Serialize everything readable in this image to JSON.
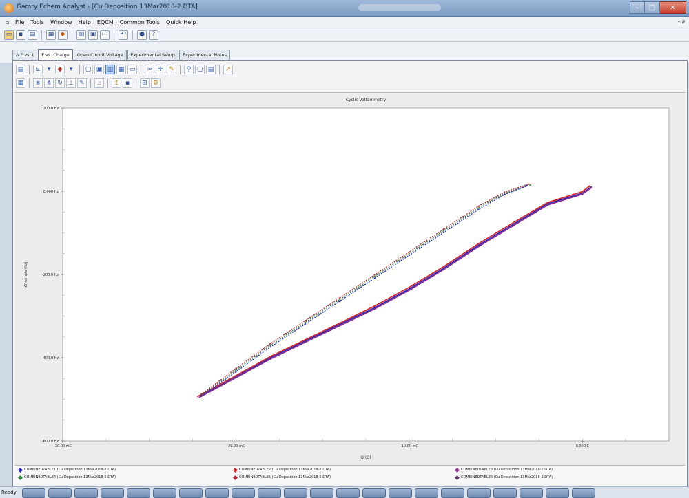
{
  "window": {
    "title": "Gamry Echem Analyst - [Cu Deposition 13Mar2018-2.DTA]",
    "minimize_glyph": "–",
    "maximize_glyph": "□",
    "close_glyph": "✕"
  },
  "menu": {
    "items": [
      "File",
      "Tools",
      "Window",
      "Help",
      "EQCM",
      "Common Tools",
      "Quick Help"
    ],
    "right_glyph": "– ∂"
  },
  "tabs": [
    {
      "label": "Δ F vs. t",
      "active": false
    },
    {
      "label": "F vs. Charge",
      "active": true
    },
    {
      "label": "Open Circuit Voltage",
      "active": false
    },
    {
      "label": "Experimental Setup",
      "active": false
    },
    {
      "label": "Experimental Notes",
      "active": false
    }
  ],
  "status": {
    "text": "Ready"
  },
  "colors": {
    "series1": "#2b2bc9",
    "series2": "#d42a2a",
    "series3": "#8a2f8a",
    "series4": "#2f8a3c",
    "series5": "#b8283a",
    "series6": "#6a3a6a"
  },
  "legend": [
    {
      "label": "COMBINEDTABLE1 (Cu Deposition 13Mar2018-2.DTA)",
      "color": "#2b2bc9"
    },
    {
      "label": "COMBINEDTABLE2 (Cu Deposition 13Mar2018-2.DTA)",
      "color": "#d42a2a"
    },
    {
      "label": "COMBINEDTABLE3 (Cu Deposition 13Mar2018-2.DTA)",
      "color": "#8a2f8a"
    },
    {
      "label": "COMBINEDTABLE4 (Cu Deposition 13Mar2018-2.DTA)",
      "color": "#2f8a3c"
    },
    {
      "label": "COMBINEDTABLE5 (Cu Deposition 13Mar2018-2.DTA)",
      "color": "#b8283a"
    },
    {
      "label": "COMBINEDTABLE6 (Cu Deposition 13Mar2018-2.DTA)",
      "color": "#6a3a6a"
    }
  ],
  "chart_data": {
    "type": "line",
    "title": "Cyclic Voltammetry",
    "xlabel": "Q (C)",
    "ylabel": "Δf sample (Hz)",
    "xlim": [
      -30,
      5
    ],
    "ylim": [
      -600,
      200
    ],
    "x_ticks": [
      {
        "value": -30,
        "label": "-30.00 mC"
      },
      {
        "value": -20,
        "label": "-20.00 mC"
      },
      {
        "value": -10,
        "label": "-10.00 mC"
      },
      {
        "value": 0,
        "label": "0.000 C"
      }
    ],
    "y_ticks": [
      {
        "value": 200,
        "label": "200.0 Hz"
      },
      {
        "value": 0,
        "label": "0.000 Hz"
      },
      {
        "value": -200,
        "label": "-200.0 Hz"
      },
      {
        "value": -400,
        "label": "-400.0 Hz"
      },
      {
        "value": -600,
        "label": "-600.0 Hz"
      }
    ],
    "grid": false,
    "series": [
      {
        "color": "#2b2bc9",
        "dashed": false,
        "x": [
          -22,
          -20,
          -18,
          -16,
          -14,
          -12,
          -10,
          -8,
          -6,
          -4,
          -2,
          0,
          0.5
        ],
        "y": [
          -490,
          -445,
          -400,
          -360,
          -320,
          -280,
          -235,
          -185,
          -130,
          -80,
          -30,
          -5,
          10
        ]
      },
      {
        "color": "#d42a2a",
        "dashed": false,
        "x": [
          -22.2,
          -20,
          -18,
          -16,
          -14,
          -12,
          -10,
          -8,
          -6,
          -4,
          -2,
          0,
          0.4
        ],
        "y": [
          -493,
          -443,
          -397,
          -357,
          -317,
          -276,
          -231,
          -181,
          -126,
          -76,
          -27,
          -1,
          12
        ]
      },
      {
        "color": "#8a2f8a",
        "dashed": false,
        "x": [
          -22.1,
          -20,
          -18,
          -16,
          -14,
          -12,
          -10,
          -8,
          -6,
          -4,
          -2,
          0,
          0.5
        ],
        "y": [
          -495,
          -448,
          -403,
          -363,
          -323,
          -283,
          -238,
          -188,
          -133,
          -83,
          -33,
          -7,
          8
        ]
      },
      {
        "color": "#2f8a3c",
        "dashed": true,
        "x": [
          -22,
          -20,
          -18,
          -16,
          -14,
          -12,
          -10,
          -8,
          -6,
          -4.5,
          -3
        ],
        "y": [
          -490,
          -430,
          -370,
          -315,
          -260,
          -205,
          -150,
          -95,
          -40,
          -5,
          15
        ]
      },
      {
        "color": "#b8283a",
        "dashed": true,
        "x": [
          -22,
          -20,
          -18,
          -16,
          -14,
          -12,
          -10,
          -8,
          -6,
          -4.5,
          -3.1
        ],
        "y": [
          -488,
          -426,
          -366,
          -311,
          -256,
          -201,
          -146,
          -91,
          -36,
          -2,
          17
        ]
      },
      {
        "color": "#2b2bc9",
        "dashed": true,
        "x": [
          -22,
          -20,
          -18,
          -16,
          -14,
          -12,
          -10,
          -8,
          -6,
          -4.5,
          -3.2
        ],
        "y": [
          -492,
          -434,
          -374,
          -319,
          -264,
          -209,
          -154,
          -99,
          -44,
          -8,
          13
        ]
      }
    ]
  }
}
